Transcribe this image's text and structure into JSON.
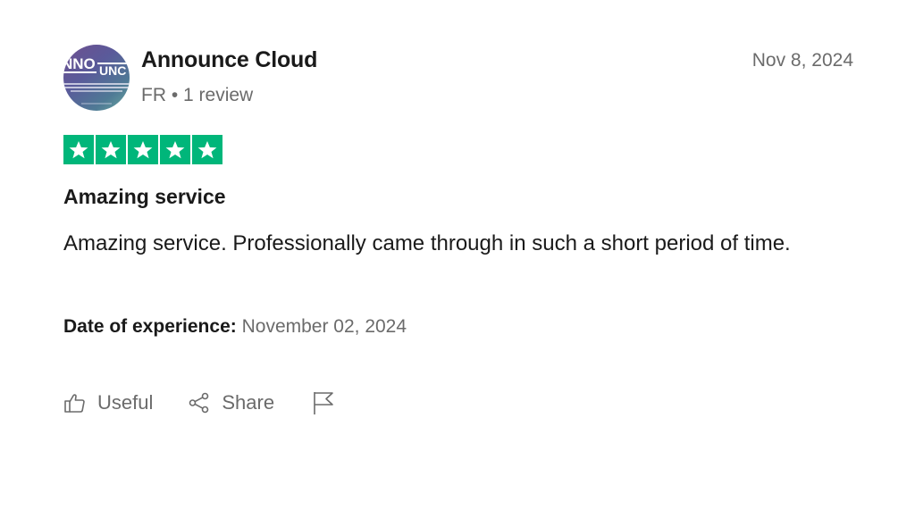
{
  "reviewer": {
    "name": "Announce Cloud",
    "meta": "FR • 1 review",
    "avatar_icon": "announce-cloud-logo"
  },
  "review": {
    "date": "Nov 8, 2024",
    "rating": 5,
    "rating_max": 5,
    "title": "Amazing service",
    "body": "Amazing service. Professionally came through in such a short period of time.",
    "experience_label": "Date of experience:",
    "experience_date": "November 02, 2024"
  },
  "actions": {
    "useful_label": "Useful",
    "share_label": "Share",
    "useful_icon": "thumbs-up-icon",
    "share_icon": "share-icon",
    "report_icon": "flag-icon"
  },
  "colors": {
    "star_green": "#00b67a",
    "text_primary": "#1a1a1a",
    "text_secondary": "#6b6b6b"
  }
}
